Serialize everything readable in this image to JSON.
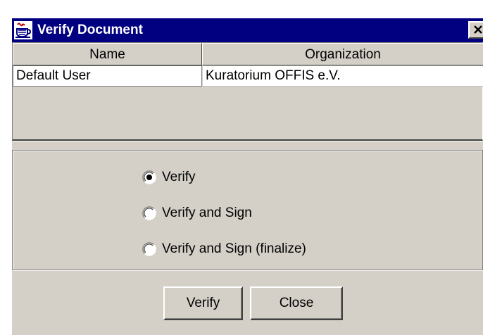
{
  "window": {
    "title": "Verify Document",
    "icon": "java-coffee-cup-icon",
    "close_icon": "close-icon"
  },
  "table": {
    "columns": [
      "Name",
      "Organization"
    ],
    "rows": [
      {
        "name": "Default User",
        "organization": "Kuratorium OFFIS e.V."
      }
    ]
  },
  "options": {
    "items": [
      {
        "label": "Verify",
        "selected": true
      },
      {
        "label": "Verify and Sign",
        "selected": false
      },
      {
        "label": "Verify and Sign (finalize)",
        "selected": false
      }
    ]
  },
  "buttons": {
    "verify_label": "Verify",
    "close_label": "Close"
  },
  "colors": {
    "titlebar": "#000080",
    "face": "#d4d0c8",
    "cell_background": "#ffffff"
  }
}
